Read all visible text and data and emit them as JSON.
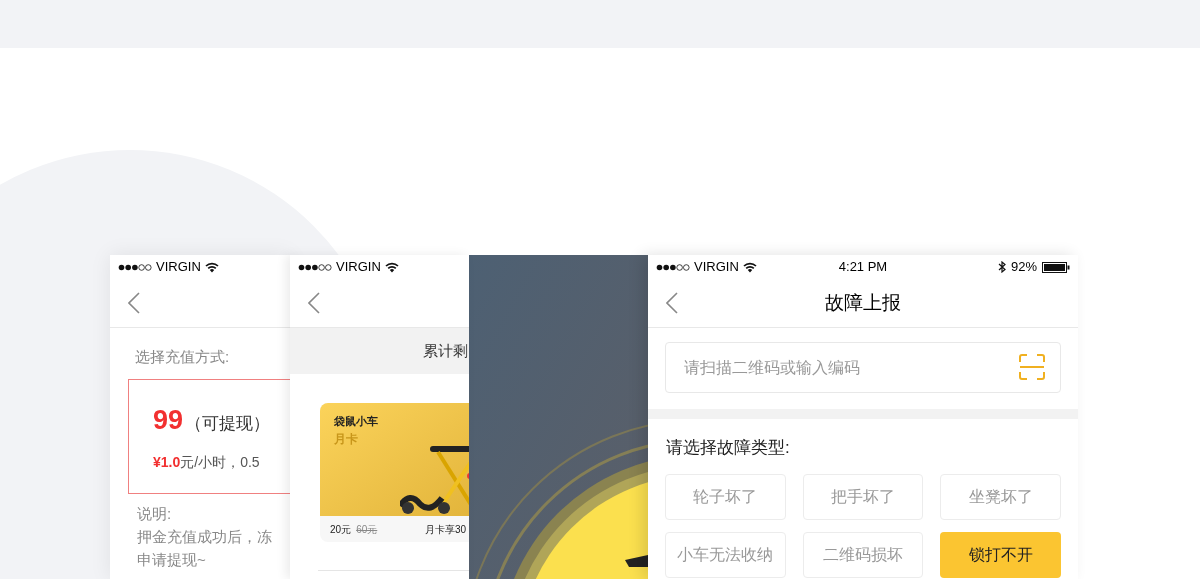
{
  "recharge_screen": {
    "carrier": "VIRGIN",
    "prompt": "选择充值方式:",
    "option": {
      "amount": "99",
      "note": "（可提现）",
      "price": "**¥1.0**元/小时，0.5",
      "selected": true
    },
    "explain_title": "说明:",
    "explain_lines": [
      "押金充值成功后，冻",
      "申请提现~"
    ]
  },
  "card_screen": {
    "carrier": "VIRGIN",
    "banner": "累计剩",
    "card": {
      "brand": "袋鼠小车",
      "name": "月卡",
      "price": "20元",
      "original_price": "60元",
      "benefit": "月卡享30"
    }
  },
  "report_screen": {
    "carrier": "VIRGIN",
    "time": "4:21 PM",
    "battery": "92%",
    "title": "故障上报",
    "code_field": {
      "placeholder": "请扫描二维码或输入编码"
    },
    "prompt": "请选择故障类型:",
    "fault_types": [
      {
        "label": "轮子坏了",
        "selected": false
      },
      {
        "label": "把手坏了",
        "selected": false
      },
      {
        "label": "坐凳坏了",
        "selected": false
      },
      {
        "label": "小车无法收纳",
        "selected": false
      },
      {
        "label": "二维码损坏",
        "selected": false
      },
      {
        "label": "锁打不开",
        "selected": true
      }
    ]
  }
}
